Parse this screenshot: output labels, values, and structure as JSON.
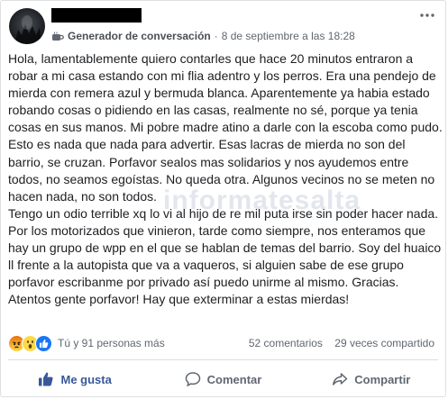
{
  "post": {
    "source_name": "Generador de conversación",
    "timestamp": "8 de septiembre a las 18:28",
    "separator": "·",
    "more_icon": "more-horizontal-icon",
    "body": "Hola, lamentablemente quiero contarles que hace 20 minutos entraron a robar a mi casa estando con mi flia adentro y los perros. Era una pendejo de mierda con remera azul y bermuda blanca. Aparentemente ya habia estado robando cosas o pidiendo en las casas, realmente no sé, porque ya tenia cosas en sus manos. Mi pobre madre atino a darle con la escoba como pudo. Esto es nada que nada para advertir. Esas lacras de mierda no son del barrio, se cruzan. Porfavor sealos mas solidarios y nos ayudemos entre todos, no seamos egoístas. No queda otra. Algunos vecinos no se meten no hacen nada, no son todos.\nTengo un odio terrible xq lo vi al hijo de re mil puta irse sin poder hacer nada. Por los motorizados que vinieron, tarde como siempre, nos enteramos que hay un grupo de wpp en el que se hablan de temas del barrio. Soy del huaico ll frente a la autopista que va a vaqueros, si alguien sabe de ese grupo porfavor escribanme por privado así puedo unirme al mismo. Gracias.\nAtentos gente porfavor! Hay que exterminar a estas mierdas!",
    "watermark": "informatesalta"
  },
  "reactions": {
    "icons": [
      "angry-reaction-icon",
      "wow-reaction-icon",
      "like-reaction-icon"
    ],
    "summary": "Tú y 91 personas más"
  },
  "stats": {
    "comments": "52 comentarios",
    "shares": "29 veces compartido"
  },
  "actions": {
    "like_label": "Me gusta",
    "comment_label": "Comentar",
    "share_label": "Compartir"
  },
  "colors": {
    "like_active": "#385898",
    "secondary_text": "#606770",
    "divider": "#dadde1"
  }
}
